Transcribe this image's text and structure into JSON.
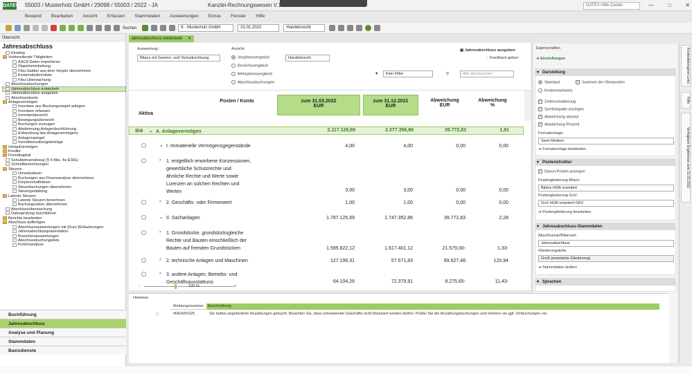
{
  "titlebar": {
    "logo": "DATEV",
    "title": "55003 / Musterholz GmbH / 29098 / 55003 / 2022 - JA",
    "apptitle": "Kanzlei-Rechnungswesen V.11.3",
    "help_placeholder": "DATEV Hilfe-Center"
  },
  "menu": [
    "Bestand",
    "Bearbeiten",
    "Ansicht",
    "Erfassen",
    "Stammdaten",
    "Auswertungen",
    "Extras",
    "Fenster",
    "Hilfe"
  ],
  "toolbar": {
    "search_label": "Suchen",
    "client_select": "6 - Musterholz GmbH",
    "date_select": "01.01.2022",
    "law_select": "Handelsrecht"
  },
  "left": {
    "header": "Übersicht",
    "section_title": "Jahresabschluss",
    "tree": [
      {
        "t": "Einstieg",
        "lvl": 1,
        "ic": "doc"
      },
      {
        "t": "Vorbereitende Tätigkeiten",
        "lvl": 0,
        "ic": "fld"
      },
      {
        "t": "ASCII-Daten importieren",
        "lvl": 2,
        "ic": "doc"
      },
      {
        "t": "Stapelverarbeitung",
        "lvl": 2,
        "ic": "doc"
      },
      {
        "t": "Fibu-Salden aus dem Vorjahr übernehmen",
        "lvl": 2,
        "ic": "doc"
      },
      {
        "t": "Kontenabstimmliste",
        "lvl": 2,
        "ic": "doc"
      },
      {
        "t": "Fibu-Überwachung",
        "lvl": 2,
        "ic": "doc"
      },
      {
        "t": "Abschlussbuchungen",
        "lvl": 1,
        "ic": "doc"
      },
      {
        "t": "Jahresabschluss entwickeln",
        "lvl": 1,
        "ic": "doc",
        "sel": true
      },
      {
        "t": "Jahresabschluss ausgeben",
        "lvl": 1,
        "ic": "doc"
      },
      {
        "t": "Abschlusskonto",
        "lvl": 1,
        "ic": "doc"
      },
      {
        "t": "Anlagevermögen",
        "lvl": 0,
        "ic": "fld"
      },
      {
        "t": "Inventare aus Buchungsstapel anlegen",
        "lvl": 2,
        "ic": "doc"
      },
      {
        "t": "Inventare erfassen",
        "lvl": 2,
        "ic": "doc"
      },
      {
        "t": "Inventarübersicht",
        "lvl": 2,
        "ic": "doc"
      },
      {
        "t": "Bewegungsübersicht",
        "lvl": 2,
        "ic": "doc"
      },
      {
        "t": "Buchungen erzeugen",
        "lvl": 2,
        "ic": "doc"
      },
      {
        "t": "Abstimmung Anlagenbuchführung",
        "lvl": 2,
        "ic": "doc"
      },
      {
        "t": "Entwicklung des Anlagevermögens",
        "lvl": 2,
        "ic": "doc"
      },
      {
        "t": "Anlagenspiegel",
        "lvl": 2,
        "ic": "doc"
      },
      {
        "t": "Investitionsabzugsbeträge",
        "lvl": 2,
        "ic": "doc"
      },
      {
        "t": "Umlaufvermögen",
        "lvl": 0,
        "ic": "fld"
      },
      {
        "t": "Kredite",
        "lvl": 0,
        "ic": "fld"
      },
      {
        "t": "Fremdkapital",
        "lvl": 0,
        "ic": "fld"
      },
      {
        "t": "Schuldzinsenabzug (§ 4 Abs. 4a EStG)",
        "lvl": 1,
        "ic": "doc"
      },
      {
        "t": "Schnellberechnungen",
        "lvl": 1,
        "ic": "doc"
      },
      {
        "t": "Steuern",
        "lvl": 0,
        "ic": "fld"
      },
      {
        "t": "Umsatzsteuer",
        "lvl": 2,
        "ic": "doc"
      },
      {
        "t": "Buchungen aus Finanzanalyse übernehmen",
        "lvl": 2,
        "ic": "doc"
      },
      {
        "t": "Körperschaftsteuer",
        "lvl": 2,
        "ic": "doc"
      },
      {
        "t": "Steuerbuchungen übernehmen",
        "lvl": 2,
        "ic": "doc"
      },
      {
        "t": "Steuergestaltung",
        "lvl": 2,
        "ic": "doc"
      },
      {
        "t": "Latente Steuern",
        "lvl": 0,
        "ic": "fld"
      },
      {
        "t": "Latente Steuern berechnen",
        "lvl": 2,
        "ic": "doc"
      },
      {
        "t": "Buchungssätze übernehmen",
        "lvl": 2,
        "ic": "doc"
      },
      {
        "t": "Abschlussüberwachung",
        "lvl": 1,
        "ic": "doc"
      },
      {
        "t": "Datenprüfung durchführen",
        "lvl": 1,
        "ic": "doc"
      },
      {
        "t": "Berichte bearbeiten",
        "lvl": 0,
        "ic": "fld"
      },
      {
        "t": "Abschluss auffertigen",
        "lvl": 0,
        "ic": "fld"
      },
      {
        "t": "Abschlussauswertungen mit (Kurz-)Erläuterungen",
        "lvl": 2,
        "ic": "doc"
      },
      {
        "t": "Jahresabschlusspräsentation",
        "lvl": 2,
        "ic": "doc"
      },
      {
        "t": "Branchenauswertungen",
        "lvl": 2,
        "ic": "doc"
      },
      {
        "t": "Abschlussbuchungsliste",
        "lvl": 2,
        "ic": "doc"
      },
      {
        "t": "Kontenanalyse",
        "lvl": 2,
        "ic": "doc"
      }
    ],
    "nav": [
      "Buchführung",
      "Jahresabschluss",
      "Analyse und Planung",
      "Stammdaten",
      "Basisdienste"
    ]
  },
  "tab": {
    "label": "Jahresabschluss entwickeln"
  },
  "filters": {
    "auswertung_label": "Auswertung:",
    "auswertung_value": "Bilanz mit Gewinn- und Verlustrechnung",
    "ansicht_label": "Ansicht:",
    "ansicht_options": [
      "Vorjahresvergleich",
      "Bereichsvergleich",
      "Mehrjahresvergleich",
      "Abschlussbuchungen"
    ],
    "recht_value": "Handelsrecht",
    "ausgeben": "Jahresabschluss ausgeben",
    "feedback": "Feedback geben",
    "filter_value": "Kein Filter",
    "search_placeholder": "Alle durchsuchen"
  },
  "grid": {
    "headers": {
      "side": "Aktiva",
      "posten": "Posten / Konto",
      "col1": "zum 31.03.2022\nEUR",
      "col2": "zum 31.12.2021\nEUR",
      "col3": "Abweichung\nEUR",
      "col4": "Abweichung\n%"
    },
    "rows": [
      {
        "label": "A.  Anlagevermögen",
        "v1": "2.117.129,69",
        "v2": "2.077.356,86",
        "v3": "39.772,83",
        "v4": "1,91",
        "first": true
      },
      {
        "label": "I.  Immaterielle Vermögensgegenstände",
        "v1": "4,00",
        "v2": "4,00",
        "v3": "0,00",
        "v4": "0,00"
      },
      {
        "label": "1.  entgeltlich erworbene Konzessionen,\ngewerbliche Schutzrechte und\nähnliche Rechte und Werte sowie\nLizenzen an solchen Rechten und\nWerten",
        "v1": "3,00",
        "v2": "3,00",
        "v3": "0,00",
        "v4": "0,00"
      },
      {
        "label": "2.  Geschäfts- oder Firmenwert",
        "v1": "1,00",
        "v2": "1,00",
        "v3": "0,00",
        "v4": "0,00"
      },
      {
        "label": "II.  Sachanlagen",
        "v1": "1.787.125,69",
        "v2": "1.747.352,86",
        "v3": "39.772,83",
        "v4": "2,28"
      },
      {
        "label": "1.  Grundstücke, grundstücksgleiche\nRechte und Bauten einschließlich der\nBauten auf fremden Grundstücken",
        "v1": "1.595.822,12",
        "v2": "1.617.401,12",
        "v3": "21.579,00-",
        "v4": "1,33-"
      },
      {
        "label": "2.  technische Anlagen und Maschinen",
        "v1": "127.199,31",
        "v2": "57.571,83",
        "v3": "69.627,48",
        "v4": "120,94"
      },
      {
        "label": "3.  andere Anlagen, Betriebs- und\nGeschäftsausstattung",
        "v1": "64.104,26",
        "v2": "72.379,91",
        "v3": "8.275,65-",
        "v4": "11,43-"
      }
    ],
    "zoom": "100 %"
  },
  "right": {
    "header": "Eigenschaften",
    "einstellungen": "Einstellungen",
    "darstellung": "Darstellung",
    "standard": "Standard",
    "kontennachweis": "Kontennachweis",
    "summen": "Summen der Oberposten",
    "zeilen": "Zeilenschattierung",
    "symbol": "Symbolspalte anzeigen",
    "abw_abs": "Abweichung absolut",
    "abw_proz": "Abweichung Prozent",
    "formatvorlage_label": "Formatvorlage:",
    "formatvorlage_value": "Semi Modern",
    "formatvorlage_link": "Formatvorlage bearbeiten",
    "postenstruktur": "Postenstruktur",
    "davon": "Davon-Posten anzeigen",
    "pg_bilanz_label": "Postengliederung Bilanz:",
    "pg_bilanz_value": "Bilanz HGB erweitert",
    "pg_guv_label": "Postengliederung GuV:",
    "pg_guv_value": "GuV HGB erweitert GKV",
    "pg_link": "Postengliederung bearbeiten",
    "stammdaten": "Jahresabschluss-Stammdaten",
    "art_label": "Abschlussart/Bilanzart:",
    "art_value": "Jahresabschluss",
    "tiefe_label": "Gliederungstiefe:",
    "tiefe_value": "Groß (erweiterte Gliederung)",
    "stamm_link": "Stammdaten ändern",
    "sprachen": "Sprachen",
    "vtabs": [
      "Kontextbezogene Links",
      "Hilfe",
      "Verfügbare Ergebnisse zum 31.03.2022"
    ]
  },
  "hinweise": {
    "title": "Hinweise",
    "col_nr": "Meldungsnummer",
    "col_desc": "Beschreibung",
    "nr": "#REW91025",
    "desc": "Sie haben angeforderte Anzahlungen gebucht. Beachten Sie, dass schwebende Geschäfte nicht bilanziert werden dürfen. Prüfen Sie die Anzahlungsbuchungen und nehmen sie ggf. Umbuchungen vor."
  }
}
